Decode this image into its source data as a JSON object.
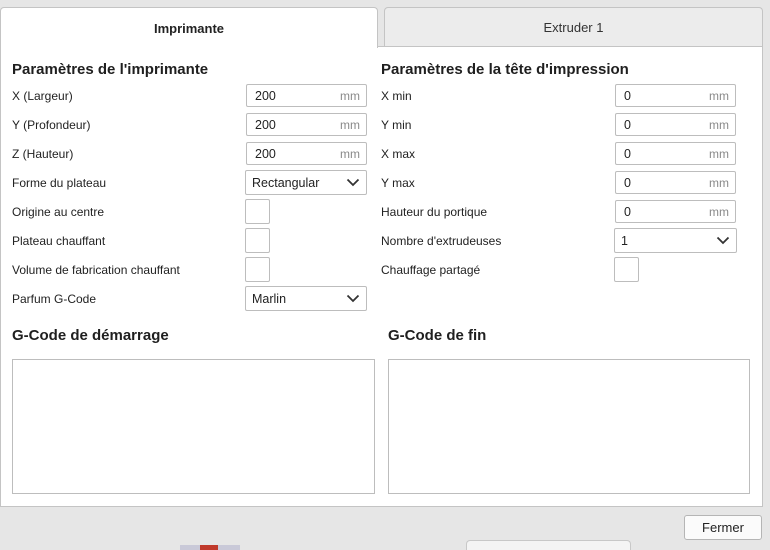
{
  "tabs": [
    {
      "label": "Imprimante",
      "active": true
    },
    {
      "label": "Extruder 1",
      "active": false
    }
  ],
  "printer_settings": {
    "title": "Paramètres de l'imprimante",
    "x_label": "X (Largeur)",
    "x_value": "200",
    "x_unit": "mm",
    "y_label": "Y (Profondeur)",
    "y_value": "200",
    "y_unit": "mm",
    "z_label": "Z (Hauteur)",
    "z_value": "200",
    "z_unit": "mm",
    "bed_shape_label": "Forme du plateau",
    "bed_shape_value": "Rectangular",
    "origin_center_label": "Origine au centre",
    "heated_bed_label": "Plateau chauffant",
    "heated_volume_label": "Volume de fabrication chauffant",
    "gcode_flavor_label": "Parfum G-Code",
    "gcode_flavor_value": "Marlin"
  },
  "printhead_settings": {
    "title": "Paramètres de la tête d'impression",
    "xmin_label": "X min",
    "xmin_value": "0",
    "xmin_unit": "mm",
    "ymin_label": "Y min",
    "ymin_value": "0",
    "ymin_unit": "mm",
    "xmax_label": "X max",
    "xmax_value": "0",
    "xmax_unit": "mm",
    "ymax_label": "Y max",
    "ymax_value": "0",
    "ymax_unit": "mm",
    "gantry_label": "Hauteur du portique",
    "gantry_value": "0",
    "gantry_unit": "mm",
    "extruder_count_label": "Nombre d'extrudeuses",
    "extruder_count_value": "1",
    "shared_heater_label": "Chauffage partagé"
  },
  "start_gcode": {
    "title": "G-Code de démarrage",
    "content": ""
  },
  "end_gcode": {
    "title": "G-Code de fin",
    "content": ""
  },
  "footer": {
    "close_label": "Fermer"
  },
  "colors": {
    "panel": "#ffffff",
    "background": "#e6e6e6",
    "border": "#c4c4c4"
  }
}
